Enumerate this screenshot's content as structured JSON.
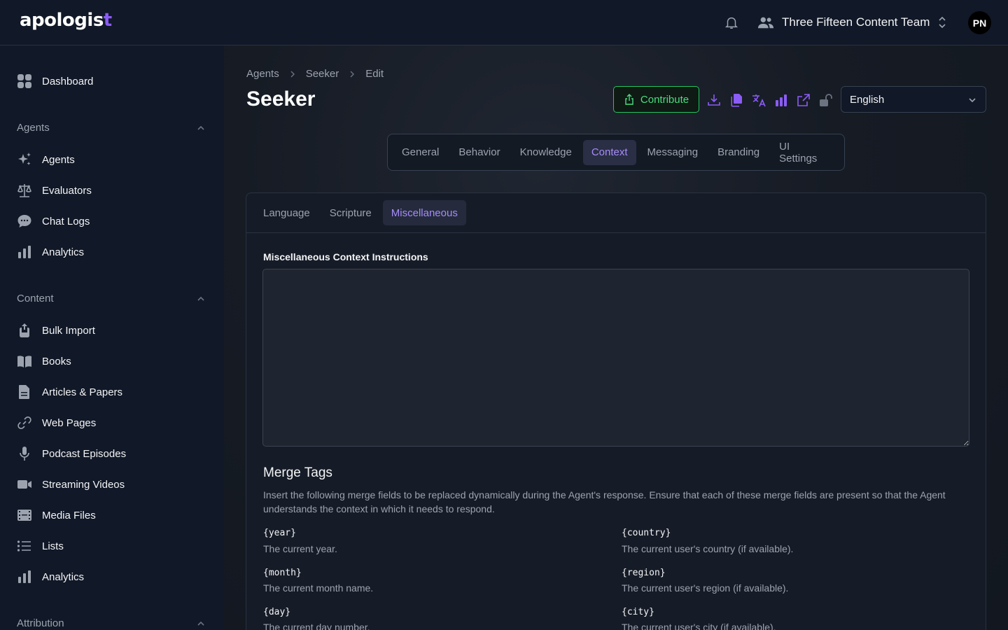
{
  "header": {
    "logo_text": "apologis",
    "logo_accent": "t",
    "team_name": "Three Fifteen Content Team",
    "avatar_initials": "PN"
  },
  "sidebar": {
    "dashboard": "Dashboard",
    "sections": [
      {
        "title": "Agents",
        "items": [
          "Agents",
          "Evaluators",
          "Chat Logs",
          "Analytics"
        ]
      },
      {
        "title": "Content",
        "items": [
          "Bulk Import",
          "Books",
          "Articles & Papers",
          "Web Pages",
          "Podcast Episodes",
          "Streaming Videos",
          "Media Files",
          "Lists",
          "Analytics"
        ]
      },
      {
        "title": "Attribution",
        "items": []
      }
    ]
  },
  "breadcrumb": [
    "Agents",
    "Seeker",
    "Edit"
  ],
  "page_title": "Seeker",
  "toolbar": {
    "contribute_label": "Contribute",
    "language_value": "English"
  },
  "tabs": [
    "General",
    "Behavior",
    "Knowledge",
    "Context",
    "Messaging",
    "Branding",
    "UI Settings"
  ],
  "active_tab": "Context",
  "subtabs": [
    "Language",
    "Scripture",
    "Miscellaneous"
  ],
  "active_subtab": "Miscellaneous",
  "form": {
    "field_label": "Miscellaneous Context Instructions",
    "field_value": ""
  },
  "merge_tags": {
    "title": "Merge Tags",
    "description": "Insert the following merge fields to be replaced dynamically during the Agent's response. Ensure that each of these merge fields are present so that the Agent understands the context in which it needs to respond.",
    "items": [
      {
        "tag": "{year}",
        "desc": "The current year."
      },
      {
        "tag": "{country}",
        "desc": "The current user's country (if available)."
      },
      {
        "tag": "{month}",
        "desc": "The current month name."
      },
      {
        "tag": "{region}",
        "desc": "The current user's region (if available)."
      },
      {
        "tag": "{day}",
        "desc": "The current day number."
      },
      {
        "tag": "{city}",
        "desc": "The current user's city (if available)."
      }
    ]
  },
  "colors": {
    "accent": "#8b5cf6",
    "success": "#22c55e",
    "background": "#111827"
  }
}
